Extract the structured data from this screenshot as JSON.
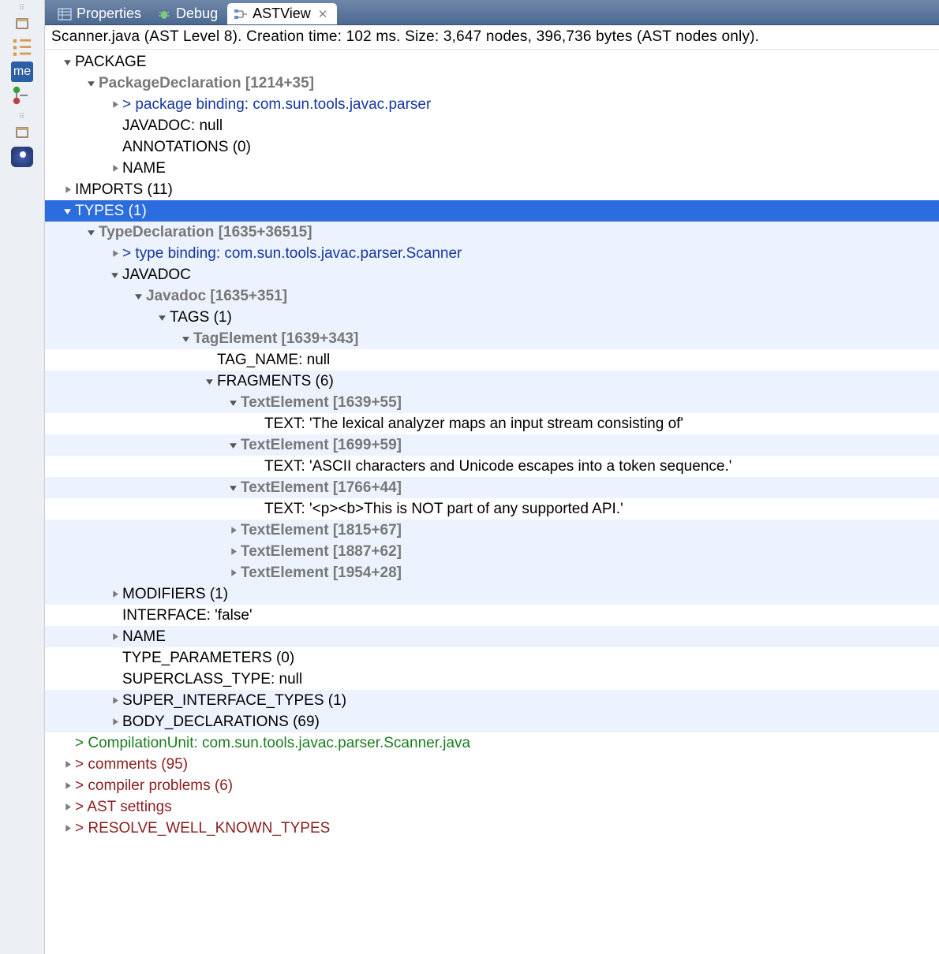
{
  "tabs": {
    "properties": "Properties",
    "debug": "Debug",
    "astview": "ASTView"
  },
  "info": "Scanner.java (AST Level 8).  Creation time: 102 ms.  Size: 3,647 nodes, 396,736 bytes (AST nodes only).",
  "tree": {
    "package": "PACKAGE",
    "packagedecl": "PackageDeclaration [1214+35]",
    "pkgbind": "> package binding: com.sun.tools.javac.parser",
    "javadocnull": "JAVADOC: null",
    "annotations": "ANNOTATIONS (0)",
    "name1": "NAME",
    "imports": "IMPORTS (11)",
    "types": "TYPES (1)",
    "typedecl": "TypeDeclaration [1635+36515]",
    "typebind": "> type binding: com.sun.tools.javac.parser.Scanner",
    "javadoc": "JAVADOC",
    "javadocnode": "Javadoc [1635+351]",
    "tags": "TAGS (1)",
    "tagelem": "TagElement [1639+343]",
    "tagname": "TAG_NAME: null",
    "fragments": "FRAGMENTS (6)",
    "te1": "TextElement [1639+55]",
    "txt1": "TEXT: 'The lexical analyzer maps an input stream consisting of'",
    "te2": "TextElement [1699+59]",
    "txt2": "TEXT: 'ASCII characters and Unicode escapes into a token sequence.'",
    "te3": "TextElement [1766+44]",
    "txt3": "TEXT: '<p><b>This is NOT part of any supported API.'",
    "te4": "TextElement [1815+67]",
    "te5": "TextElement [1887+62]",
    "te6": "TextElement [1954+28]",
    "modifiers": "MODIFIERS (1)",
    "interface": "INTERFACE: 'false'",
    "name2": "NAME",
    "typeparams": "TYPE_PARAMETERS (0)",
    "superclass": "SUPERCLASS_TYPE: null",
    "superif": "SUPER_INTERFACE_TYPES (1)",
    "bodydecls": "BODY_DECLARATIONS (69)",
    "compunit": "> CompilationUnit: com.sun.tools.javac.parser.Scanner.java",
    "comments": "> comments (95)",
    "problems": "> compiler problems (6)",
    "astsettings": "> AST settings",
    "resolve": "> RESOLVE_WELL_KNOWN_TYPES"
  },
  "gutter": {
    "me": "me"
  }
}
